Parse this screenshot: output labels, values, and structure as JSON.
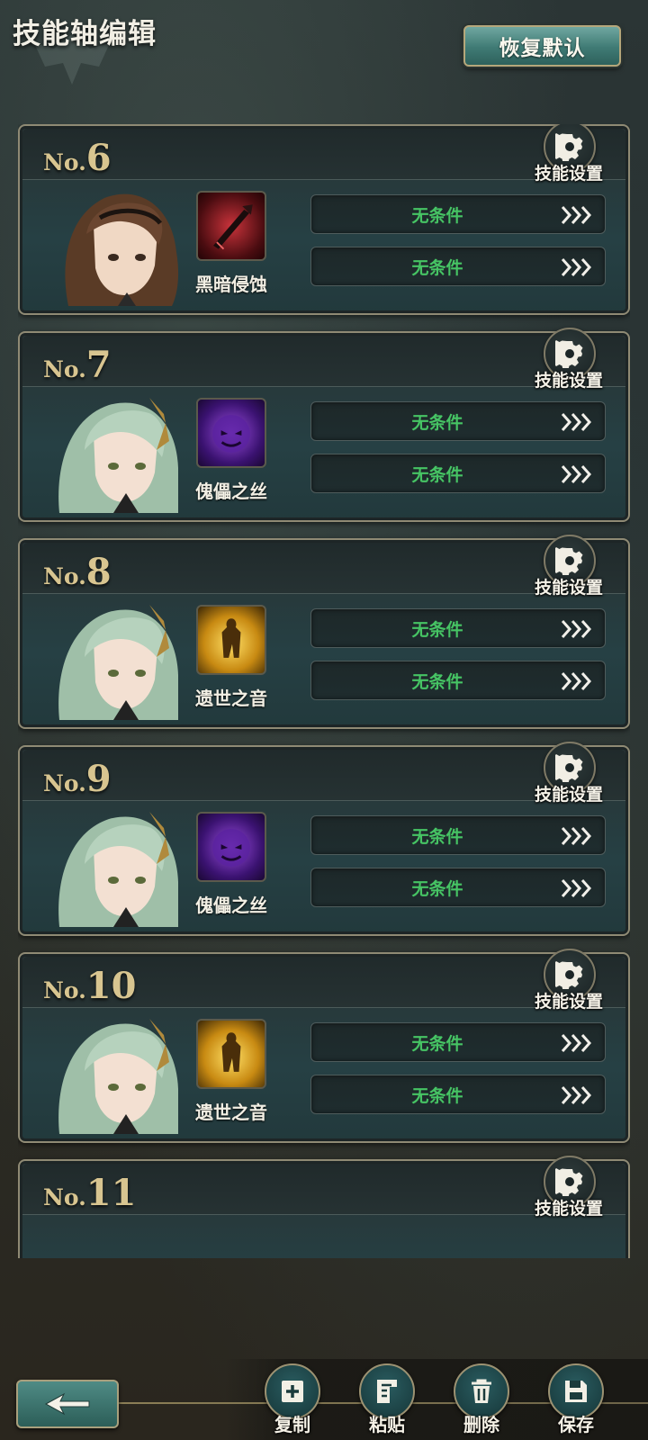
{
  "header": {
    "title": "技能轴编辑",
    "reset_label": "恢复默认"
  },
  "cards": [
    {
      "no_prefix": "No.",
      "no": "6",
      "gear_label": "技能设置",
      "skill": "黑暗侵蚀",
      "skill_icon": "dark-blade-icon",
      "character": "brown-haired",
      "conditions": [
        "无条件",
        "无条件"
      ]
    },
    {
      "no_prefix": "No.",
      "no": "7",
      "gear_label": "技能设置",
      "skill": "傀儡之丝",
      "skill_icon": "purple-face-icon",
      "character": "green-haired",
      "conditions": [
        "无条件",
        "无条件"
      ]
    },
    {
      "no_prefix": "No.",
      "no": "8",
      "gear_label": "技能设置",
      "skill": "遗世之音",
      "skill_icon": "golden-figure-icon",
      "character": "green-haired",
      "conditions": [
        "无条件",
        "无条件"
      ]
    },
    {
      "no_prefix": "No.",
      "no": "9",
      "gear_label": "技能设置",
      "skill": "傀儡之丝",
      "skill_icon": "purple-face-icon",
      "character": "green-haired",
      "conditions": [
        "无条件",
        "无条件"
      ]
    },
    {
      "no_prefix": "No.",
      "no": "10",
      "gear_label": "技能设置",
      "skill": "遗世之音",
      "skill_icon": "golden-figure-icon",
      "character": "green-haired",
      "conditions": [
        "无条件",
        "无条件"
      ]
    },
    {
      "no_prefix": "No.",
      "no": "11",
      "gear_label": "技能设置"
    }
  ],
  "actions": [
    {
      "label": "复制",
      "icon": "copy-icon"
    },
    {
      "label": "粘贴",
      "icon": "paste-icon"
    },
    {
      "label": "删除",
      "icon": "trash-icon"
    },
    {
      "label": "保存",
      "icon": "save-icon"
    }
  ],
  "back_icon": "back-arrow-icon",
  "colors": {
    "condition_text": "#46c464",
    "number_gold": "#d8c590",
    "accent_teal": "#3f7a74"
  }
}
